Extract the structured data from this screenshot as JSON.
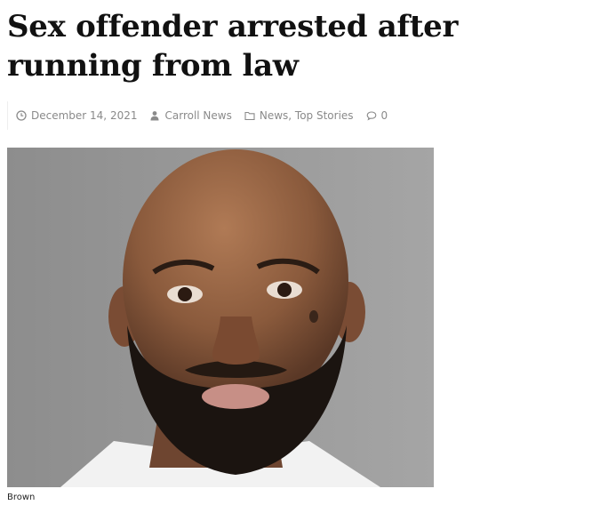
{
  "article": {
    "title": "Sex offender arrested after running from law",
    "date": "December 14, 2021",
    "author": "Carroll News",
    "categories": "News, Top Stories",
    "comments": "0",
    "image_caption": "Brown"
  },
  "icons": {
    "date": "clock-icon",
    "author": "user-icon",
    "categories": "folder-icon",
    "comments": "comment-icon"
  },
  "colors": {
    "meta_text": "#8a8a8a",
    "headline": "#111111"
  }
}
